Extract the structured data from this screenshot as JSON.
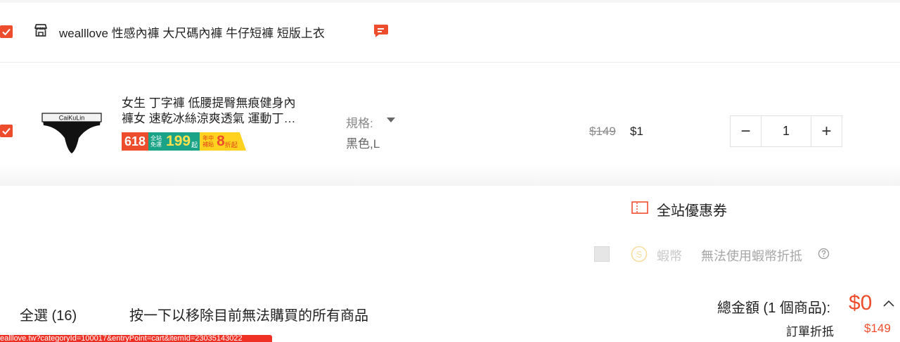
{
  "shop": {
    "name": "wealllove 性感內褲 大尺碼內褲 牛仔短褲 短版上衣"
  },
  "item": {
    "name_line1": "女生 丁字褲 低腰提臀無痕健身內",
    "name_line2": "褲女 速乾冰絲涼爽透氣 運動丁…",
    "thumb_brand": "CaiKuLin",
    "promo": {
      "event": "618",
      "free_ship_small": "全站免運",
      "free_ship_amount": "199",
      "free_ship_suffix": "起",
      "discount_small": "年中補貼",
      "discount_amount": "8",
      "discount_suffix": "折起"
    },
    "variation_label": "規格:",
    "variation_value": "黑色,L",
    "original_price": "$149",
    "price": "$1",
    "quantity": "1",
    "minus": "−",
    "plus": "+"
  },
  "voucher": {
    "label": "全站優惠券"
  },
  "coins": {
    "label": "蝦幣",
    "note": "無法使用蝦幣折抵"
  },
  "footer": {
    "select_all": "全選 (16)",
    "remove_unavailable": "按一下以移除目前無法購買的所有商品",
    "total_label": "總金額 (1 個商品):",
    "total_amount": "$0",
    "saved_label": "訂單折抵",
    "saved_amount": "$149"
  },
  "status_bar": {
    "url": "ealllove.tw?categoryId=100017&entryPoint=cart&itemId=23035143022"
  },
  "colors": {
    "accent": "#ee4d2d",
    "promo_green": "#1aa386",
    "promo_yellow": "#ffd21f"
  }
}
